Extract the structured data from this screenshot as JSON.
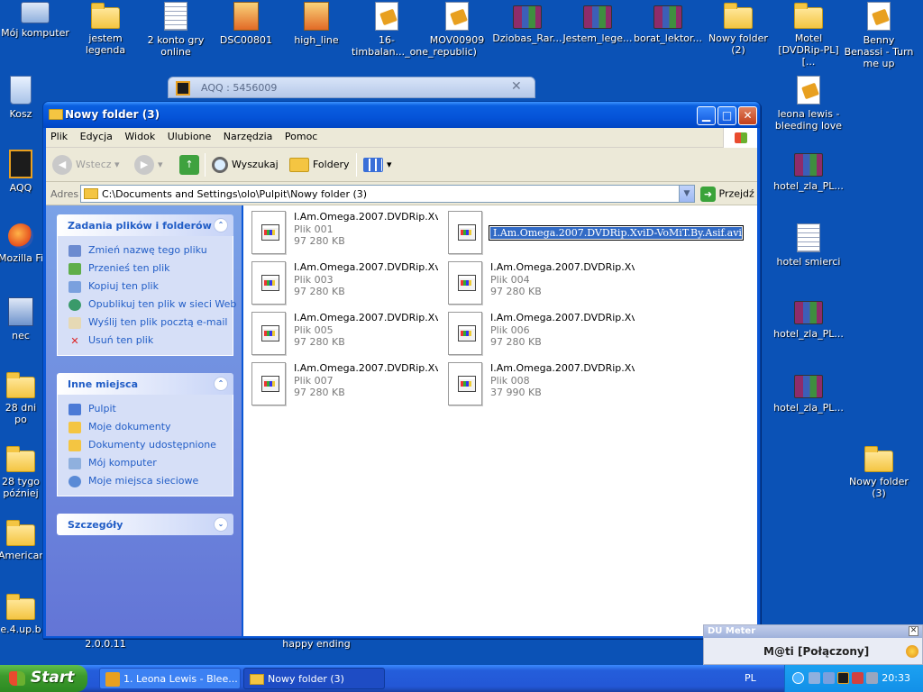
{
  "desktop_icons": [
    {
      "label": "Mój komputer",
      "icon": "computer-icon"
    },
    {
      "label": "jestem legenda",
      "icon": "folder-icon"
    },
    {
      "label": "2 konto gry online",
      "icon": "document-icon"
    },
    {
      "label": "DSC00801",
      "icon": "image-icon"
    },
    {
      "label": "high_line",
      "icon": "image-icon"
    },
    {
      "label": "16-timbalan..._one_republic)",
      "icon": "media-file-icon"
    },
    {
      "label": "MOV00909",
      "icon": "media-file-icon"
    },
    {
      "label": "Dziobas_Rar...",
      "icon": "rar-archive-icon"
    },
    {
      "label": "Jestem_lege...",
      "icon": "rar-archive-icon"
    },
    {
      "label": "borat_lektor...",
      "icon": "rar-archive-icon"
    },
    {
      "label": "Nowy folder (2)",
      "icon": "folder-icon"
    },
    {
      "label": "Motel [DVDRip-PL][...",
      "icon": "folder-icon"
    },
    {
      "label": "Benny Benassi - Turn me up",
      "icon": "media-file-icon"
    },
    {
      "label": "Kosz",
      "icon": "recycle-bin-icon"
    },
    {
      "label": "AQQ",
      "icon": "aqq-icon"
    },
    {
      "label": "Mozilla Fi",
      "icon": "firefox-icon"
    },
    {
      "label": "nec",
      "icon": "network-icon"
    },
    {
      "label": "28 dni po",
      "icon": "folder-icon"
    },
    {
      "label": "28 tygo później",
      "icon": "folder-icon"
    },
    {
      "label": "American",
      "icon": "folder-icon"
    },
    {
      "label": "e.4.up.b",
      "icon": "folder-icon"
    },
    {
      "label": "leona lewis - bleeding love",
      "icon": "media-file-icon"
    },
    {
      "label": "hotel_zla_PL...",
      "icon": "rar-archive-icon"
    },
    {
      "label": "hotel smierci",
      "icon": "document-icon"
    },
    {
      "label": "hotel_zla_PL...",
      "icon": "rar-archive-icon"
    },
    {
      "label": "hotel_zla_PL...",
      "icon": "rar-archive-icon"
    },
    {
      "label": "Nowy folder (3)",
      "icon": "folder-icon"
    },
    {
      "label": "2.0.0.11",
      "icon": "none"
    },
    {
      "label": "happy ending",
      "icon": "none"
    }
  ],
  "background_window": {
    "title": "AQQ : 5456009"
  },
  "window": {
    "title": "Nowy folder (3)",
    "menu": [
      "Plik",
      "Edycja",
      "Widok",
      "Ulubione",
      "Narzędzia",
      "Pomoc"
    ],
    "toolbar": {
      "back": "Wstecz",
      "search": "Wyszukaj",
      "folders": "Foldery"
    },
    "address": {
      "label": "Adres",
      "path": "C:\\Documents and Settings\\olo\\Pulpit\\Nowy folder (3)",
      "go": "Przejdź"
    },
    "tasks_panel": {
      "title": "Zadania plików i folderów",
      "items": [
        "Zmień nazwę tego pliku",
        "Przenieś ten plik",
        "Kopiuj ten plik",
        "Opublikuj ten plik w sieci Web",
        "Wyślij ten plik pocztą e-mail",
        "Usuń ten plik"
      ]
    },
    "places_panel": {
      "title": "Inne miejsca",
      "items": [
        "Pulpit",
        "Moje dokumenty",
        "Dokumenty udostępnione",
        "Mój komputer",
        "Moje miejsca sieciowe"
      ]
    },
    "details_panel": {
      "title": "Szczegóły"
    },
    "files": [
      {
        "name": "I.Am.Omega.2007.DVDRip.Xvi...",
        "kind": "Plik 001",
        "size": "97 280 KB"
      },
      {
        "name": "I.Am.Omega.2007.DVDRip.XviD-VoMiT.By.Asif.avi.002",
        "kind": "",
        "size": "",
        "renaming": true
      },
      {
        "name": "I.Am.Omega.2007.DVDRip.Xvi...",
        "kind": "Plik 003",
        "size": "97 280 KB"
      },
      {
        "name": "I.Am.Omega.2007.DVDRip.Xvi...",
        "kind": "Plik 004",
        "size": "97 280 KB"
      },
      {
        "name": "I.Am.Omega.2007.DVDRip.Xvi...",
        "kind": "Plik 005",
        "size": "97 280 KB"
      },
      {
        "name": "I.Am.Omega.2007.DVDRip.Xvi...",
        "kind": "Plik 006",
        "size": "97 280 KB"
      },
      {
        "name": "I.Am.Omega.2007.DVDRip.Xvi...",
        "kind": "Plik 007",
        "size": "97 280 KB"
      },
      {
        "name": "I.Am.Omega.2007.DVDRip.Xvi...",
        "kind": "Plik 008",
        "size": "37 990 KB"
      }
    ]
  },
  "du_meter": {
    "title": "DU Meter",
    "status": "M@ti [Połączony]"
  },
  "taskbar": {
    "start": "Start",
    "tasks": [
      "1. Leona Lewis - Blee...",
      "Nowy folder (3)"
    ],
    "language": "PL",
    "clock": "20:33"
  },
  "colors": {
    "desktop": "#0b52b6",
    "titlebar": "#0553d8",
    "task_link": "#215dc6",
    "selection": "#316ac5"
  }
}
